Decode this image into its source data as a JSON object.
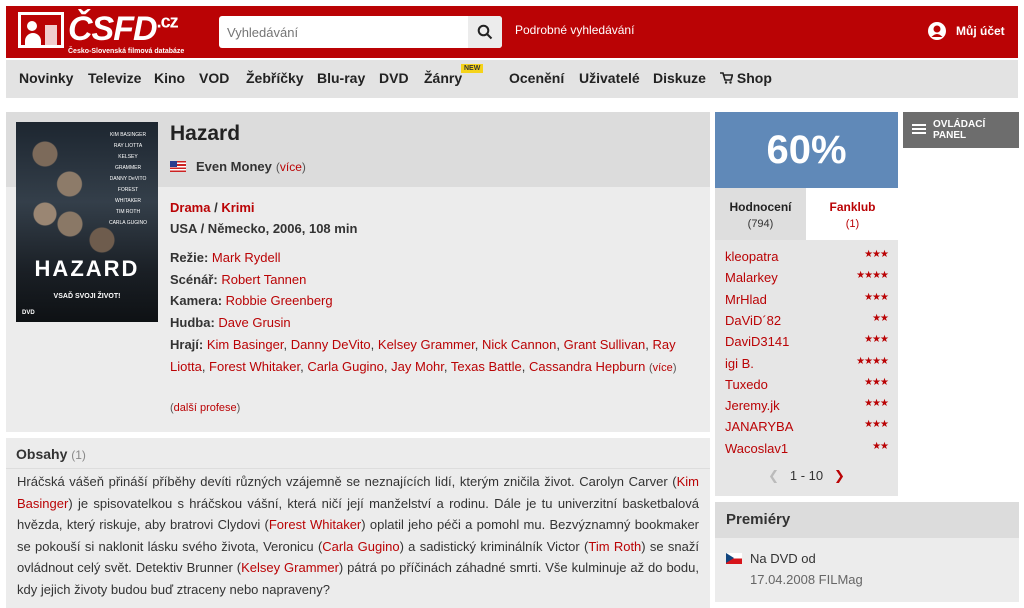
{
  "header": {
    "logo_text": "ČSFD",
    "logo_domain": ".cz",
    "logo_tagline": "Česko-Slovenská filmová databáze",
    "search_placeholder": "Vyhledávání",
    "advanced_search": "Podrobné vyhledávání",
    "account_label": "Můj účet"
  },
  "nav": {
    "items": [
      "Novinky",
      "Televize",
      "Kino",
      "VOD",
      "Žebříčky",
      "Blu-ray",
      "DVD",
      "Žánry",
      "Ocenění",
      "Uživatelé",
      "Diskuze",
      "Shop"
    ],
    "badge": "NEW"
  },
  "film": {
    "title": "Hazard",
    "alt_name": "Even Money",
    "more": "více",
    "genres": [
      "Drama",
      "Krimi"
    ],
    "origin": "USA / Německo, 2006, 108 min",
    "poster": {
      "names": [
        "KIM BASINGER",
        "RAY LIOTTA",
        "KELSEY GRAMMER",
        "DANNY DeVITO",
        "FOREST WHITAKER",
        "TIM ROTH",
        "CARLA GUGINO"
      ],
      "title": "HAZARD",
      "tagline": "VSAĎ SVOJI ŽIVOT!",
      "dvd": "DVD"
    },
    "crew": {
      "directing_label": "Režie:",
      "directing": "Mark Rydell",
      "writing_label": "Scénář:",
      "writing": "Robert Tannen",
      "camera_label": "Kamera:",
      "camera": "Robbie Greenberg",
      "music_label": "Hudba:",
      "music": "Dave Grusin"
    },
    "cast_label": "Hrají:",
    "cast": [
      "Kim Basinger",
      "Danny DeVito",
      "Kelsey Grammer",
      "Nick Cannon",
      "Grant Sullivan",
      "Ray Liotta",
      "Forest Whitaker",
      "Carla Gugino",
      "Jay Mohr",
      "Texas Battle",
      "Cassandra Hepburn"
    ],
    "cast_more": "více",
    "more_professions": "další profese"
  },
  "plot": {
    "title": "Obsahy",
    "count": "(1)",
    "segments": [
      {
        "t": "Hráčská vášeň přináší příběhy devíti různých vzájemně se neznajících lidí, kterým zničila život. Carolyn Carver ("
      },
      {
        "l": "Kim Basinger"
      },
      {
        "t": ") je spisovatelkou s hráčskou vášní, která ničí její manželství a rodinu. Dále je tu univerzitní basketbalová hvězda, který riskuje, aby bratrovi Clydovi ("
      },
      {
        "l": "Forest Whitaker"
      },
      {
        "t": ") oplatil jeho péči a pomohl mu. Bezvýznamný bookmaker se pokouší si naklonit lásku svého života, Veronicu ("
      },
      {
        "l": "Carla Gugino"
      },
      {
        "t": ") a sadistický kriminálník Victor ("
      },
      {
        "l": "Tim Roth"
      },
      {
        "t": ") se snaží ovládnout celý svět. Detektiv Brunner ("
      },
      {
        "l": "Kelsey Grammer"
      },
      {
        "t": ") pátrá po příčinách záhadné smrti. Vše kulminuje až do bodu, kdy jejich životy budou buď ztraceny nebo napraveny?"
      }
    ]
  },
  "rating": {
    "value": "60%",
    "color": "#6089b8",
    "tab_ratings": "Hodnocení",
    "tab_ratings_count": "(794)",
    "tab_fanclub": "Fanklub",
    "tab_fanclub_count": "(1)",
    "users": [
      {
        "name": "kleopatra",
        "stars": "★★★"
      },
      {
        "name": "Malarkey",
        "stars": "★★★★"
      },
      {
        "name": "MrHlad",
        "stars": "★★★"
      },
      {
        "name": "DaViD´82",
        "stars": "★★"
      },
      {
        "name": "DaviD3141",
        "stars": "★★★"
      },
      {
        "name": "igi B.",
        "stars": "★★★★"
      },
      {
        "name": "Tuxedo",
        "stars": "★★★"
      },
      {
        "name": "Jeremy.jk",
        "stars": "★★★"
      },
      {
        "name": "JANARYBA",
        "stars": "★★★"
      },
      {
        "name": "Wacoslav1",
        "stars": "★★"
      }
    ],
    "pager": "1 - 10"
  },
  "panel_button": "OVLÁDACÍ PANEL",
  "premieres": {
    "title": "Premiéry",
    "label": "Na DVD od",
    "date": "17.04.2008 FILMag"
  }
}
